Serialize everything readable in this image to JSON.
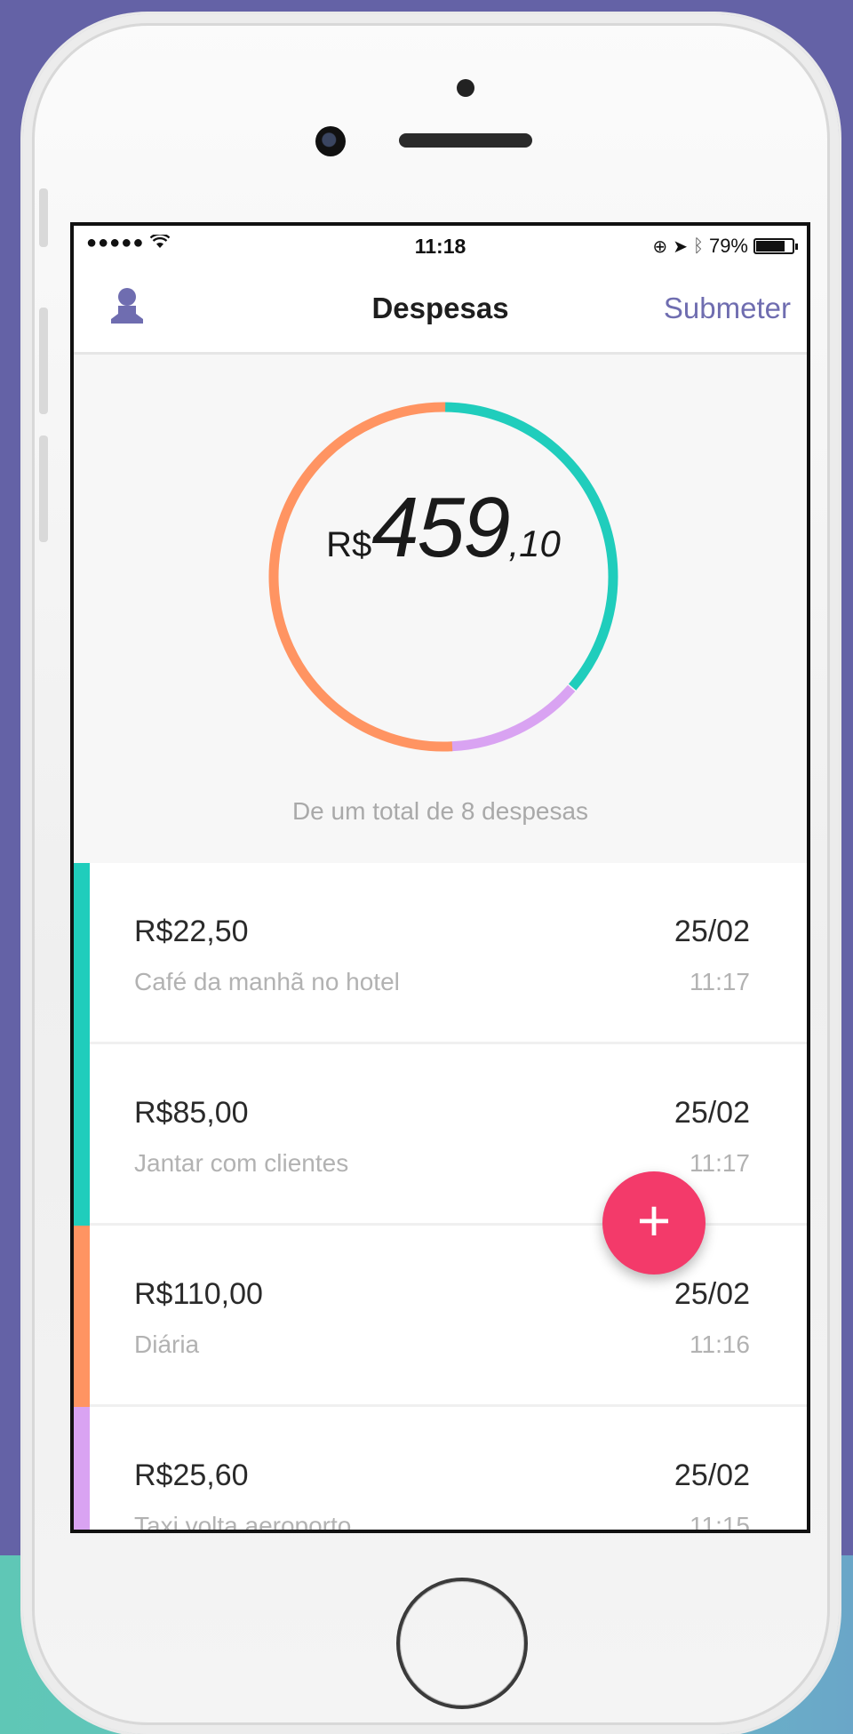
{
  "status_bar": {
    "signal": "●●●●● ",
    "wifi_icon": "wifi-icon",
    "time": "11:18",
    "battery_percent": "79%",
    "battery_level": 0.79
  },
  "nav": {
    "title": "Despesas",
    "action_label": "Submeter",
    "left_icon": "user-icon"
  },
  "summary": {
    "currency": "R$",
    "amount_integer": "459",
    "amount_decimal": ",10",
    "subtitle": "De um total de 8 despesas"
  },
  "colors": {
    "teal": "#20cdbc",
    "orange": "#ff9462",
    "lilac": "#d9a3f2",
    "accent": "#6f6db0",
    "fab": "#f33a6a"
  },
  "expenses": [
    {
      "amount": "R$22,50",
      "description": "Café da manhã no hotel",
      "date": "25/02",
      "time": "11:17",
      "category_color": "#20cdbc"
    },
    {
      "amount": "R$85,00",
      "description": "Jantar com clientes",
      "date": "25/02",
      "time": "11:17",
      "category_color": "#20cdbc"
    },
    {
      "amount": "R$110,00",
      "description": "Diária",
      "date": "25/02",
      "time": "11:16",
      "category_color": "#ff9462"
    },
    {
      "amount": "R$25,60",
      "description": "Taxi volta aeroporto",
      "date": "25/02",
      "time": "11:15",
      "category_color": "#d9a3f2"
    }
  ],
  "fab": {
    "label": "+"
  }
}
